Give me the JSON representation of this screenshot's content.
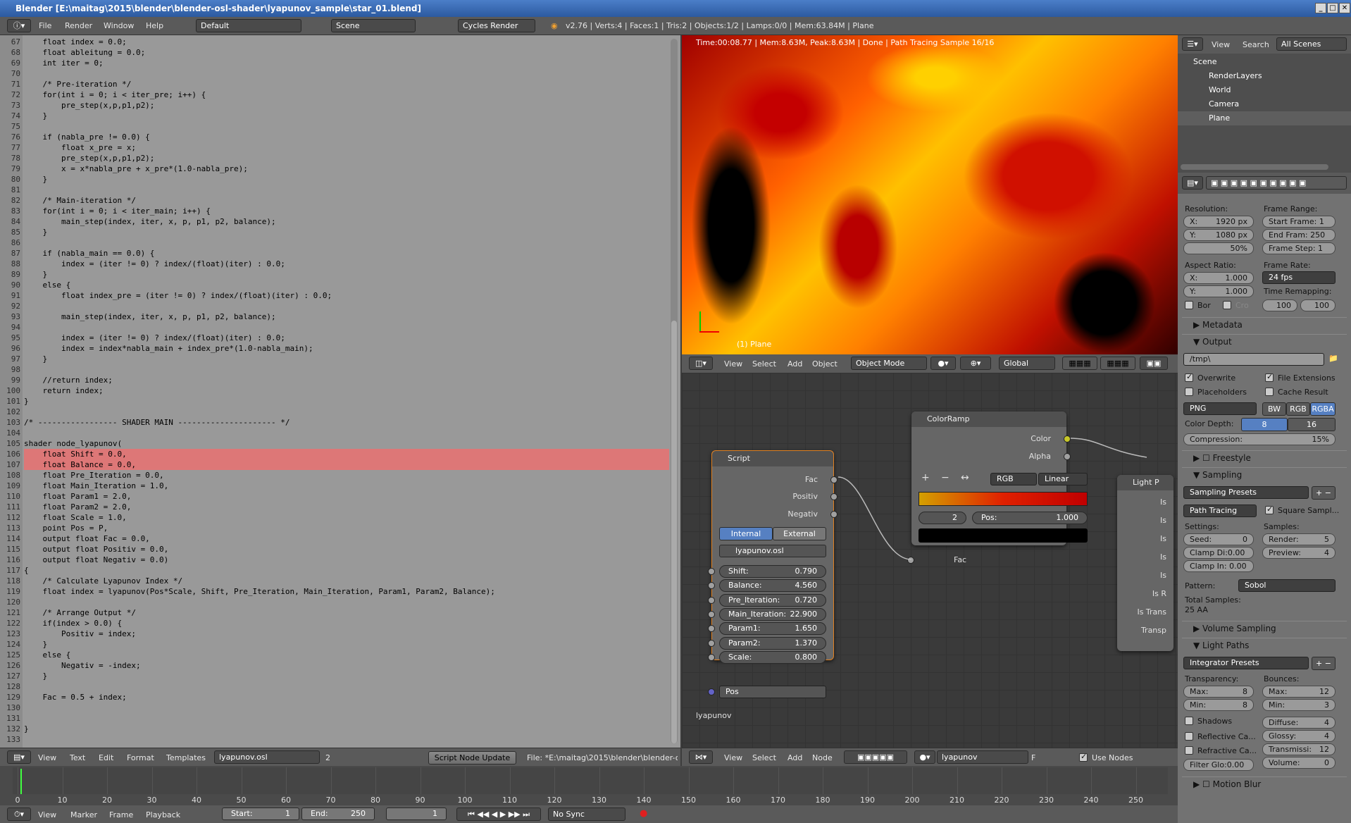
{
  "window": {
    "title": "Blender [E:\\maitag\\2015\\blender\\blender-osl-shader\\lyapunov_sample\\star_01.blend]"
  },
  "info_header": {
    "menus": [
      "File",
      "Render",
      "Window",
      "Help"
    ],
    "layout": "Default",
    "scene": "Scene",
    "engine": "Cycles Render",
    "stats": "v2.76 | Verts:4 | Faces:1 | Tris:2 | Objects:1/2 | Lamps:0/0 | Mem:63.84M | Plane"
  },
  "code_lines": [
    {
      "n": "67",
      "t": "    float index = 0.0;"
    },
    {
      "n": "68",
      "t": "    float ableitung = 0.0;"
    },
    {
      "n": "69",
      "t": "    int iter = 0;"
    },
    {
      "n": "70",
      "t": ""
    },
    {
      "n": "71",
      "t": "    /* Pre-iteration */"
    },
    {
      "n": "72",
      "t": "    for(int i = 0; i < iter_pre; i++) {"
    },
    {
      "n": "73",
      "t": "        pre_step(x,p,p1,p2);"
    },
    {
      "n": "74",
      "t": "    }"
    },
    {
      "n": "75",
      "t": ""
    },
    {
      "n": "76",
      "t": "    if (nabla_pre != 0.0) {"
    },
    {
      "n": "77",
      "t": "        float x_pre = x;"
    },
    {
      "n": "78",
      "t": "        pre_step(x,p,p1,p2);"
    },
    {
      "n": "79",
      "t": "        x = x*nabla_pre + x_pre*(1.0-nabla_pre);"
    },
    {
      "n": "80",
      "t": "    }"
    },
    {
      "n": "81",
      "t": ""
    },
    {
      "n": "82",
      "t": "    /* Main-iteration */"
    },
    {
      "n": "83",
      "t": "    for(int i = 0; i < iter_main; i++) {"
    },
    {
      "n": "84",
      "t": "        main_step(index, iter, x, p, p1, p2, balance);"
    },
    {
      "n": "85",
      "t": "    }"
    },
    {
      "n": "86",
      "t": ""
    },
    {
      "n": "87",
      "t": "    if (nabla_main == 0.0) {"
    },
    {
      "n": "88",
      "t": "        index = (iter != 0) ? index/(float)(iter) : 0.0;"
    },
    {
      "n": "89",
      "t": "    }"
    },
    {
      "n": "90",
      "t": "    else {"
    },
    {
      "n": "91",
      "t": "        float index_pre = (iter != 0) ? index/(float)(iter) : 0.0;"
    },
    {
      "n": "92",
      "t": ""
    },
    {
      "n": "93",
      "t": "        main_step(index, iter, x, p, p1, p2, balance);"
    },
    {
      "n": "94",
      "t": ""
    },
    {
      "n": "95",
      "t": "        index = (iter != 0) ? index/(float)(iter) : 0.0;"
    },
    {
      "n": "96",
      "t": "        index = index*nabla_main + index_pre*(1.0-nabla_main);"
    },
    {
      "n": "97",
      "t": "    }"
    },
    {
      "n": "98",
      "t": ""
    },
    {
      "n": "99",
      "t": "    //return index;"
    },
    {
      "n": "100",
      "t": "    return index;"
    },
    {
      "n": "101",
      "t": "}"
    },
    {
      "n": "102",
      "t": ""
    },
    {
      "n": "103",
      "t": "/* ----------------- SHADER MAIN --------------------- */"
    },
    {
      "n": "104",
      "t": ""
    },
    {
      "n": "105",
      "t": "shader node_lyapunov("
    },
    {
      "n": "106",
      "t": "    float Shift = 0.0,"
    },
    {
      "n": "107",
      "t": "    float Balance = 0.0,"
    },
    {
      "n": "108",
      "t": "    float Pre_Iteration = 0.0,"
    },
    {
      "n": "109",
      "t": "    float Main_Iteration = 1.0,"
    },
    {
      "n": "110",
      "t": "    float Param1 = 2.0,"
    },
    {
      "n": "111",
      "t": "    float Param2 = 2.0,"
    },
    {
      "n": "112",
      "t": "    float Scale = 1.0,"
    },
    {
      "n": "113",
      "t": "    point Pos = P,"
    },
    {
      "n": "114",
      "t": "    output float Fac = 0.0,"
    },
    {
      "n": "115",
      "t": "    output float Positiv = 0.0,"
    },
    {
      "n": "116",
      "t": "    output float Negativ = 0.0)"
    },
    {
      "n": "117",
      "t": "{"
    },
    {
      "n": "118",
      "t": "    /* Calculate Lyapunov Index */"
    },
    {
      "n": "119",
      "t": "    float index = lyapunov(Pos*Scale, Shift, Pre_Iteration, Main_Iteration, Param1, Param2, Balance);"
    },
    {
      "n": "120",
      "t": ""
    },
    {
      "n": "121",
      "t": "    /* Arrange Output */"
    },
    {
      "n": "122",
      "t": "    if(index > 0.0) {"
    },
    {
      "n": "123",
      "t": "        Positiv = index;"
    },
    {
      "n": "124",
      "t": "    }"
    },
    {
      "n": "125",
      "t": "    else {"
    },
    {
      "n": "126",
      "t": "        Negativ = -index;"
    },
    {
      "n": "127",
      "t": "    }"
    },
    {
      "n": "128",
      "t": ""
    },
    {
      "n": "129",
      "t": "    Fac = 0.5 + index;"
    },
    {
      "n": "130",
      "t": ""
    },
    {
      "n": "131",
      "t": ""
    },
    {
      "n": "132",
      "t": "}"
    },
    {
      "n": "133",
      "t": ""
    }
  ],
  "text_header": {
    "menus": [
      "View",
      "Text",
      "Edit",
      "Format",
      "Templates"
    ],
    "file": "lyapunov.osl",
    "users": "2",
    "update_btn": "Script Node Update",
    "path": "File: *E:\\maitag\\2015\\blender\\blender-osl"
  },
  "viewport": {
    "info": "Time:00:08.77 | Mem:8.63M, Peak:8.63M | Done | Path Tracing Sample 16/16",
    "object": "(1) Plane",
    "menus": [
      "View",
      "Select",
      "Add",
      "Object"
    ],
    "mode": "Object Mode",
    "orientation": "Global"
  },
  "script_node": {
    "title": "Script",
    "outputs": [
      "Fac",
      "Positiv",
      "Negativ"
    ],
    "tab_internal": "Internal",
    "tab_external": "External",
    "file": "lyapunov.osl",
    "inputs": [
      {
        "label": "Shift:",
        "value": "0.790"
      },
      {
        "label": "Balance:",
        "value": "4.560"
      },
      {
        "label": "Pre_Iteration:",
        "value": "0.720"
      },
      {
        "label": "Main_Iteration:",
        "value": "22.900"
      },
      {
        "label": "Param1:",
        "value": "1.650"
      },
      {
        "label": "Param2:",
        "value": "1.370"
      },
      {
        "label": "Scale:",
        "value": "0.800"
      }
    ],
    "pos": "Pos"
  },
  "colorramp_node": {
    "title": "ColorRamp",
    "outputs": [
      "Color",
      "Alpha"
    ],
    "mode": "RGB",
    "interp": "Linear",
    "index": "2",
    "pos_label": "Pos:",
    "pos_value": "1.000",
    "input": "Fac"
  },
  "light_node": {
    "title": "Light P",
    "rows": [
      "Is",
      "Is",
      "Is",
      "Is",
      "Is",
      "Is R",
      "Is Trans",
      "Transp"
    ]
  },
  "node_editor": {
    "group_label": "lyapunov",
    "menus": [
      "View",
      "Select",
      "Add",
      "Node"
    ],
    "material": "lyapunov",
    "use_nodes": "Use Nodes",
    "fake_user": "F"
  },
  "timeline": {
    "ticks": [
      "0",
      "10",
      "20",
      "30",
      "40",
      "50",
      "60",
      "70",
      "80",
      "90",
      "100",
      "110",
      "120",
      "130",
      "140",
      "150",
      "160",
      "170",
      "180",
      "190",
      "200",
      "210",
      "220",
      "230",
      "240",
      "250"
    ],
    "menus": [
      "View",
      "Marker",
      "Frame",
      "Playback"
    ],
    "start_label": "Start:",
    "start": "1",
    "end_label": "End:",
    "end": "250",
    "current": "1",
    "sync": "No Sync"
  },
  "outliner": {
    "menus": [
      "View",
      "Search"
    ],
    "filter": "All Scenes",
    "items": [
      "Scene",
      "RenderLayers",
      "World",
      "Camera",
      "Plane"
    ]
  },
  "properties": {
    "resolution_label": "Resolution:",
    "res_x": "1920 px",
    "res_y": "1080 px",
    "res_pct": "50%",
    "frame_range_label": "Frame Range:",
    "start_frame": "Start Frame: 1",
    "end_frame": "End Fram: 250",
    "frame_step": "Frame Step: 1",
    "aspect_label": "Aspect Ratio:",
    "aspect_x": "1.000",
    "aspect_y": "1.000",
    "frame_rate_label": "Frame Rate:",
    "fps": "24 fps",
    "time_remap_label": "Time Remapping:",
    "remap_old": "100",
    "remap_new": "100",
    "bor": "Bor",
    "cro": "Cro",
    "metadata": "Metadata",
    "output": "Output",
    "path": "/tmp\\",
    "overwrite": "Overwrite",
    "file_ext": "File Extensions",
    "placeholders": "Placeholders",
    "cache_result": "Cache Result",
    "format": "PNG",
    "bw": "BW",
    "rgb": "RGB",
    "rgba": "RGBA",
    "color_depth": "Color Depth:",
    "depth8": "8",
    "depth16": "16",
    "compression": "Compression:",
    "compression_val": "15%",
    "freestyle": "Freestyle",
    "sampling": "Sampling",
    "sampling_presets": "Sampling Presets",
    "path_tracing": "Path Tracing",
    "square_samples": "Square Sampl...",
    "settings": "Settings:",
    "samples": "Samples:",
    "seed": "Seed:",
    "seed_val": "0",
    "render": "Render:",
    "render_val": "5",
    "clamp_direct": "Clamp Di:0.00",
    "preview": "Preview:",
    "preview_val": "4",
    "clamp_indirect": "Clamp In: 0.00",
    "pattern": "Pattern:",
    "pattern_val": "Sobol",
    "total_samples": "Total Samples:",
    "total_aa": "25 AA",
    "volume_sampling": "Volume Sampling",
    "light_paths": "Light Paths",
    "integrator": "Integrator Presets",
    "transparency": "Transparency:",
    "bounces": "Bounces:",
    "t_max": "Max:",
    "t_max_val": "8",
    "b_max": "Max:",
    "b_max_val": "12",
    "t_min": "Min:",
    "t_min_val": "8",
    "b_min": "Min:",
    "b_min_val": "3",
    "shadows": "Shadows",
    "diffuse": "Diffuse:",
    "diffuse_val": "4",
    "reflective": "Reflective Ca...",
    "glossy": "Glossy:",
    "glossy_val": "4",
    "refractive": "Refractive Ca...",
    "transmission": "Transmissi:",
    "transmission_val": "12",
    "filter_glossy": "Filter Glo:0.00",
    "volume": "Volume:",
    "volume_val": "0",
    "motion_blur": "Motion Blur"
  }
}
